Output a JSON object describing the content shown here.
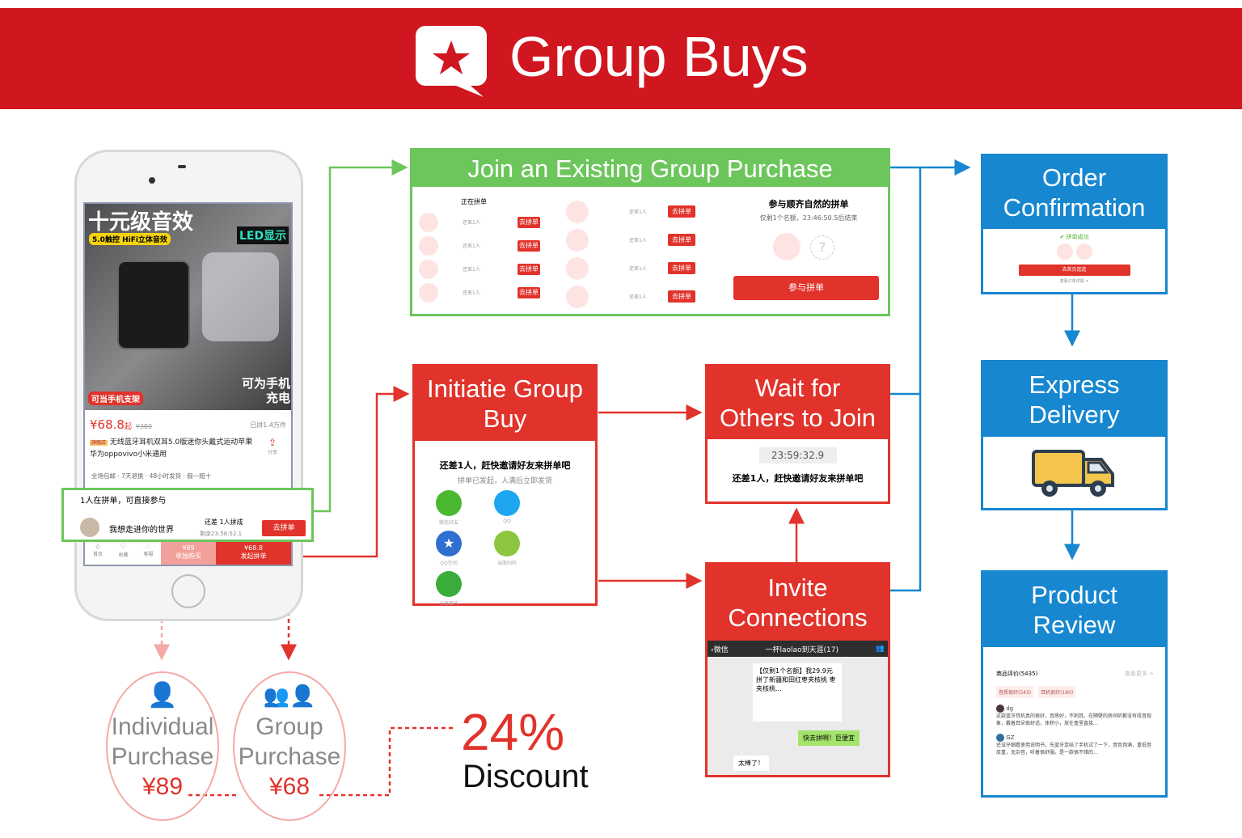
{
  "header": {
    "title": "Group Buys",
    "logo_icon": "star-speech-bubble-icon"
  },
  "colors": {
    "brand_red": "#d0161f",
    "red": "#e1332b",
    "blue": "#1787d0",
    "green": "#6cc65c",
    "pink": "#f3aaa6"
  },
  "phone": {
    "banner_title": "十元级音效",
    "banner_tag": "5.0触控 HiFi立体音效",
    "banner_led": "LED显示",
    "banner_stand": "可当手机支架",
    "banner_charge": "可为手机充电",
    "price": "¥68.8",
    "price_suffix": "起",
    "orig_price": "¥389",
    "sold": "已拼1.4万件",
    "store_badge": "旗舰店",
    "product_name": "无线蓝牙耳机双耳5.0版迷你头戴式运动苹果华为oppovivo小米通用",
    "share": "分享",
    "services": "全场包邮 · 7天退换 · 48小时发货 · 假一赔十",
    "join_title": "1人在拼单，可直接参与",
    "join_user": "我想走进你的世界",
    "join_need": "还差 1人拼成",
    "join_remain": "剩余23:58:52.1",
    "join_btn": "去拼单",
    "nav": [
      {
        "label": "首页",
        "icon": "home-icon"
      },
      {
        "label": "收藏",
        "icon": "heart-icon"
      },
      {
        "label": "客服",
        "icon": "chat-icon"
      }
    ],
    "solo_price": "¥89",
    "solo_label": "单独购买",
    "group_price": "¥68.8",
    "group_label": "发起拼单"
  },
  "join_box": {
    "title": "Join an Existing Group Purchase",
    "list_title": "正在拼单",
    "need": "还差1人",
    "go": "去拼单",
    "right_title": "参与顺齐自然的拼单",
    "right_sub": "仅剩1个名额，23:46:50.5后结束",
    "button": "参与拼单"
  },
  "initiate_box": {
    "title": "Initiatie Group Buy",
    "main": "还差1人，赶快邀请好友来拼单吧",
    "sub": "拼单已发起，人满后立即发货",
    "shares": [
      {
        "label": "微信好友",
        "color": "#4cb830"
      },
      {
        "label": "QQ",
        "color": "#1fa6f0"
      },
      {
        "label": "QQ空间",
        "color": "#2f6fd0"
      },
      {
        "label": "当面扫码",
        "color": "#8cc63f"
      },
      {
        "label": "分享图片",
        "color": "#3aad3a"
      }
    ]
  },
  "wait_box": {
    "title": "Wait for Others to Join",
    "timer": "23:59:32.9",
    "text": "还差1人，赶快邀请好友来拼单吧"
  },
  "invite_box": {
    "title": "Invite Connections",
    "back": "微信",
    "chat_title": "一杯laolao到天涯(17)",
    "card_title": "【仅剩1个名额】我29.9元拼了新疆和田红枣夹核桃 枣夹核桃...",
    "msg_green": "快去拼啊！巨便宜",
    "msg_white": "太棒了！"
  },
  "order_box": {
    "title": "Order Confirmation",
    "success": "拼单成功",
    "button": "去首页逛逛",
    "detail": "查看订单详情 >"
  },
  "delivery_box": {
    "title": "Express Delivery",
    "icon": "delivery-truck-icon"
  },
  "review_box": {
    "title": "Product Review",
    "heading": "商品评价(5435)",
    "more": "查看更多 >",
    "tags": [
      "音质很好(543)",
      "耳机很好(180)"
    ],
    "reviews": [
      {
        "user": "dg",
        "text": "这款蓝牙耳机真的很好，音质好，不刺耳。在隔壁的房间听都没有段音现象，戴着耳朵很舒适，体积小，放在盒里直接..."
      },
      {
        "user": "GZ",
        "text": "还没仔细看使用说明书，先蓝牙连结了手机试了一下，音色饱满，重低音厚重，无杂音，听着很舒服。是一款很不错的..."
      }
    ]
  },
  "comparison": {
    "individual": {
      "line1": "Individual",
      "line2": "Purchase",
      "price": "¥89"
    },
    "group": {
      "line1": "Group",
      "line2": "Purchase",
      "price": "¥68"
    },
    "discount_value": "24%",
    "discount_label": "Discount"
  }
}
